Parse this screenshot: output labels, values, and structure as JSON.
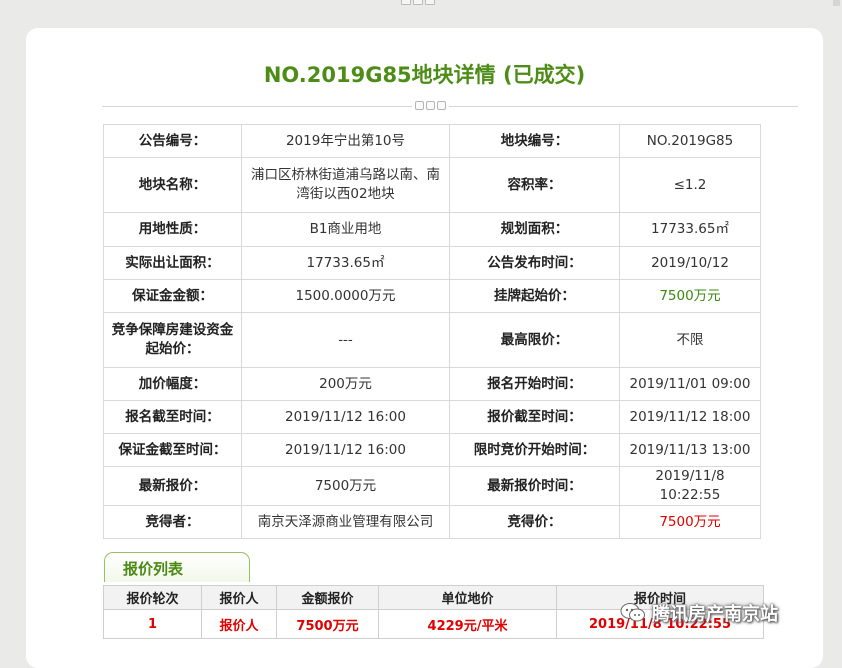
{
  "title": "NO.2019G85地块详情 (已成交)",
  "details": [
    [
      {
        "label": "公告编号：",
        "value": "2019年宁出第10号"
      },
      {
        "label": "地块编号：",
        "value": "NO.2019G85"
      }
    ],
    [
      {
        "label": "地块名称：",
        "value": "浦口区桥林街道浦乌路以南、南湾街以西02地块"
      },
      {
        "label": "容积率：",
        "value": "≤1.2"
      }
    ],
    [
      {
        "label": "用地性质：",
        "value": "B1商业用地"
      },
      {
        "label": "规划面积：",
        "value": "17733.65㎡"
      }
    ],
    [
      {
        "label": "实际出让面积：",
        "value": "17733.65㎡"
      },
      {
        "label": "公告发布时间：",
        "value": "2019/10/12"
      }
    ],
    [
      {
        "label": "保证金金额：",
        "value": "1500.0000万元"
      },
      {
        "label": "挂牌起始价：",
        "value": "7500万元"
      }
    ],
    [
      {
        "label": "竞争保障房建设资金起始价：",
        "value": "---"
      },
      {
        "label": "最高限价：",
        "value": "不限"
      }
    ],
    [
      {
        "label": "加价幅度：",
        "value": "200万元"
      },
      {
        "label": "报名开始时间：",
        "value": "2019/11/01 09:00"
      }
    ],
    [
      {
        "label": "报名截至时间：",
        "value": "2019/11/12 16:00"
      },
      {
        "label": "报价截至时间：",
        "value": "2019/11/12 18:00"
      }
    ],
    [
      {
        "label": "保证金截至时间：",
        "value": "2019/11/12 16:00"
      },
      {
        "label": "限时竞价开始时间：",
        "value": "2019/11/13 13:00"
      }
    ],
    [
      {
        "label": "最新报价：",
        "value": "7500万元"
      },
      {
        "label": "最新报价时间：",
        "value": "2019/11/8 10:22:55"
      }
    ],
    [
      {
        "label": "竞得者：",
        "value": "南京天泽源商业管理有限公司"
      },
      {
        "label": "竞得价：",
        "value": "7500万元"
      }
    ]
  ],
  "bid_section": {
    "tab_label": "报价列表",
    "headers": [
      "报价轮次",
      "报价人",
      "金额报价",
      "单位地价",
      "报价时间"
    ],
    "rows": [
      [
        "1",
        "报价人",
        "7500万元",
        "4229元/平米",
        "2019/11/8 10:22:55"
      ]
    ]
  },
  "watermark": {
    "text": "腾讯房产南京站",
    "icon": "wechat-icon"
  },
  "colors": {
    "title_green": "#4d8d17",
    "value_green": "#3a8a10",
    "value_red": "#e00000",
    "tab_border": "#97c25f"
  }
}
